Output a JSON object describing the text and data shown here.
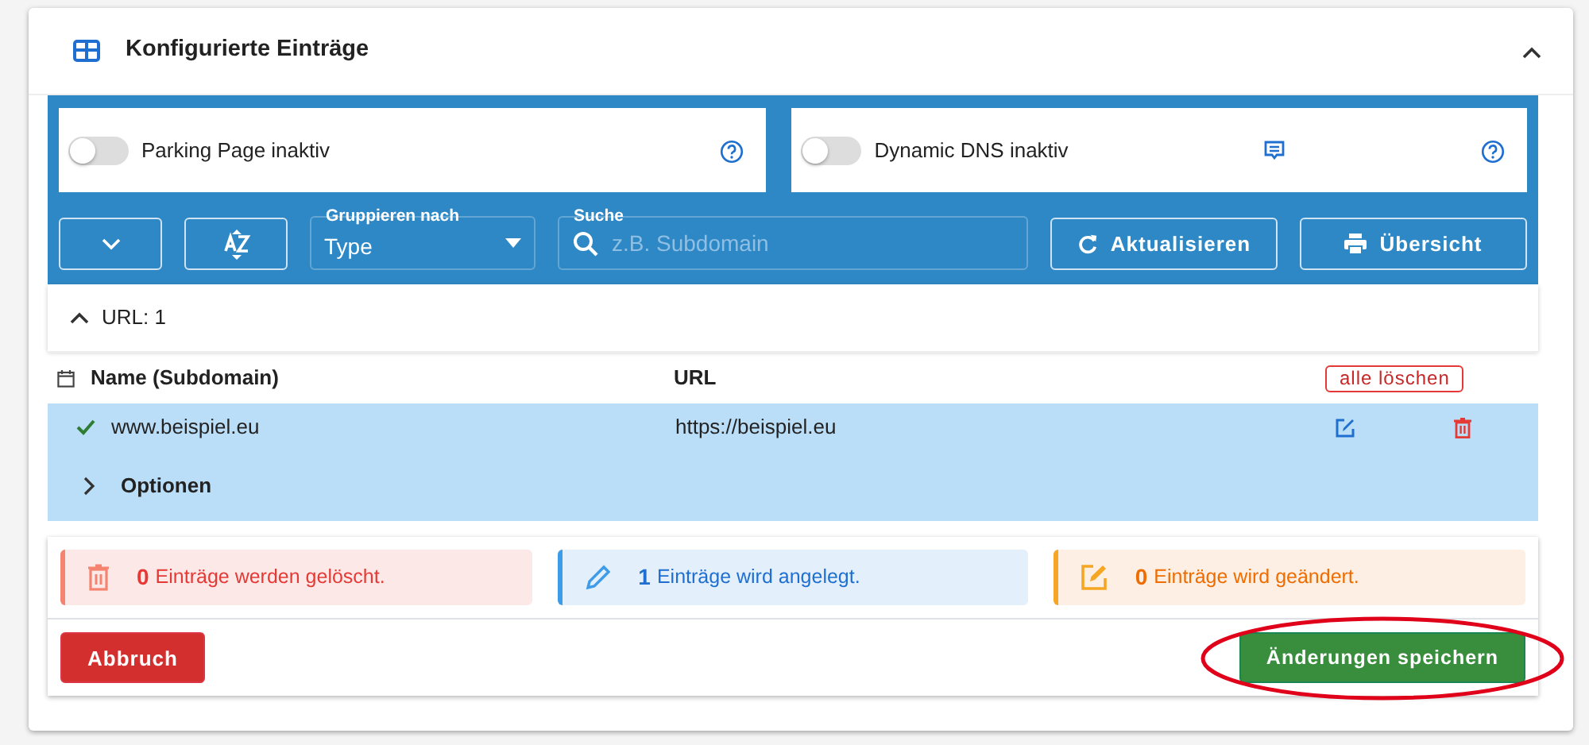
{
  "panel": {
    "title": "Konfigurierte Einträge",
    "expanded": true
  },
  "toggles": [
    {
      "label": "Parking Page inaktiv",
      "on": false,
      "note": false
    },
    {
      "label": "Dynamic DNS inaktiv",
      "on": false,
      "note": true
    }
  ],
  "toolbar": {
    "group_by": {
      "label": "Gruppieren nach",
      "value": "Type"
    },
    "search": {
      "label": "Suche",
      "placeholder": "z.B. Subdomain"
    },
    "buttons": [
      {
        "kind": "refresh",
        "label": "Aktualisieren"
      },
      {
        "kind": "print",
        "label": "Übersicht"
      }
    ]
  },
  "group": {
    "label": "URL: 1",
    "expanded": true
  },
  "table": {
    "columns": [
      "Name (Subdomain)",
      "URL"
    ],
    "delete_all": "alle löschen",
    "rows": [
      {
        "name": "www.beispiel.eu",
        "url": "https://beispiel.eu",
        "valid": true,
        "selected": true,
        "options": {
          "label": "Optionen",
          "expanded": false
        }
      }
    ]
  },
  "summary": [
    {
      "kind": "delete",
      "count": "0",
      "text": "Einträge werden gelöscht."
    },
    {
      "kind": "create",
      "count": "1",
      "text": "Einträge wird angelegt."
    },
    {
      "kind": "change",
      "count": "0",
      "text": "Einträge wird geändert."
    }
  ],
  "actions": {
    "cancel": "Abbruch",
    "save": "Änderungen speichern",
    "save_highlighted": true
  }
}
